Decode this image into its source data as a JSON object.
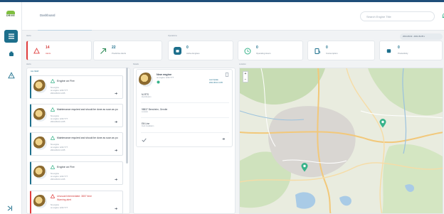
{
  "header": {
    "breadcrumb": "Dashboard",
    "search_placeholder": "Search Engine Title"
  },
  "sections": {
    "alerts": "Alerts",
    "operations": "Operations",
    "alert_list": "Alerts",
    "details": "Details",
    "location": "Location"
  },
  "date_range": "2021-08-02 - 2021-09-05 ▾",
  "stats": {
    "alerts": {
      "value": "14",
      "label": "Alerts"
    },
    "predictive": {
      "value": "22",
      "label": "Predictive Alerts"
    },
    "active": {
      "value": "0",
      "label": "Active Engines"
    },
    "hours": {
      "value": "0",
      "label": "Operating Hours"
    },
    "consumption": {
      "value": "0",
      "label": "Consumption"
    },
    "productivity": {
      "value": "0",
      "label": "Productivity"
    }
  },
  "alerts": {
    "list_header": "ALL NEW",
    "items": [
      {
        "title": "Engine on Fire",
        "line1": "No engine",
        "line2": "on engine: 1234 TYT",
        "line3": "2021-08-01 14:05",
        "danger": false
      },
      {
        "title": "Maintenance required and should be done as soon as po",
        "line1": "No engine",
        "line2": "on engine: 1234 TYT",
        "line3": "2021-08-01 14:05",
        "danger": false
      },
      {
        "title": "Maintenance required and should be done as soon as po",
        "line1": "No engine",
        "line2": "on engine: 1234 TYT",
        "line3": "2021-08-01 14:05",
        "danger": false
      },
      {
        "title": "Engine on Fire",
        "line1": "No engine",
        "line2": "on engine: 1234 TYT",
        "line3": "2021-08-01 14:05",
        "danger": false
      },
      {
        "title": "Unusual Intermediate: 3807 time",
        "title2": "Warning alert",
        "line1": "No engine",
        "line2": "on engine: 1234 TYT",
        "line3": "",
        "danger": true
      }
    ]
  },
  "detail": {
    "name": "New engine",
    "sub": "on engine: 1234 TYT",
    "meta_label": "Last Update",
    "meta_value": "2021-08-01 14:05",
    "field1": "M-RTS",
    "field1_sub": "Identification",
    "field2": "98837 Bensheim, Gerotte",
    "field2_sub": "Location",
    "field3": "Elli Line",
    "field3_sub": "Field Installation"
  },
  "map": {
    "zoom_in": "+",
    "zoom_out": "−"
  },
  "colors": {
    "primary": "#1d6f8c",
    "alert_red": "#e03c3c",
    "success_green": "#37b38a"
  }
}
